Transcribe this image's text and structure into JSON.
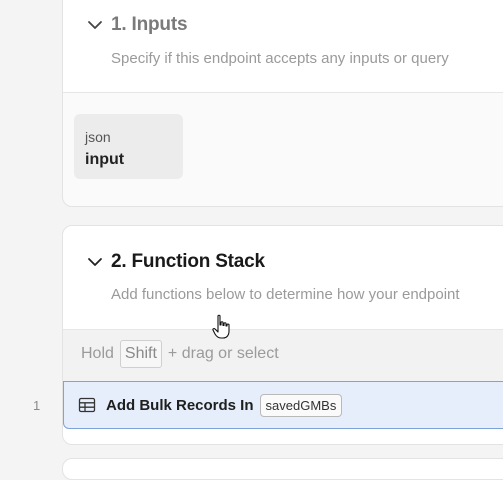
{
  "inputs_section": {
    "title": "1. Inputs",
    "subtitle": "Specify if this endpoint accepts any inputs or query",
    "input": {
      "type": "json",
      "name": "input"
    }
  },
  "function_stack": {
    "title": "2. Function Stack",
    "subtitle": "Add functions below to determine how your endpoint",
    "hint": {
      "prefix": "Hold",
      "key": "Shift",
      "suffix": "+ drag or select"
    },
    "steps": [
      {
        "number": "1",
        "label": "Add Bulk Records In",
        "variable": "savedGMBs",
        "icon": "table-icon"
      }
    ]
  },
  "colors": {
    "selection_bg": "#e6eefb",
    "selection_border": "#7ea3d6"
  }
}
